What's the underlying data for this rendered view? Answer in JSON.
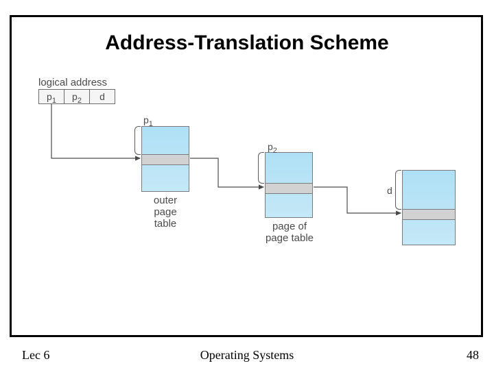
{
  "title": "Address-Translation Scheme",
  "footer": {
    "left": "Lec 6",
    "center": "Operating Systems",
    "right": "48"
  },
  "diagram": {
    "logical_address_label": "logical address",
    "fields": {
      "p1": "p",
      "p1_sub": "1",
      "p2": "p",
      "p2_sub": "2",
      "d": "d"
    },
    "brace_labels": {
      "outer": "p",
      "outer_sub": "1",
      "inner": "p",
      "inner_sub": "2",
      "page": "d"
    },
    "table_labels": {
      "outer": "outer page\ntable",
      "inner": "page of\npage table"
    }
  }
}
